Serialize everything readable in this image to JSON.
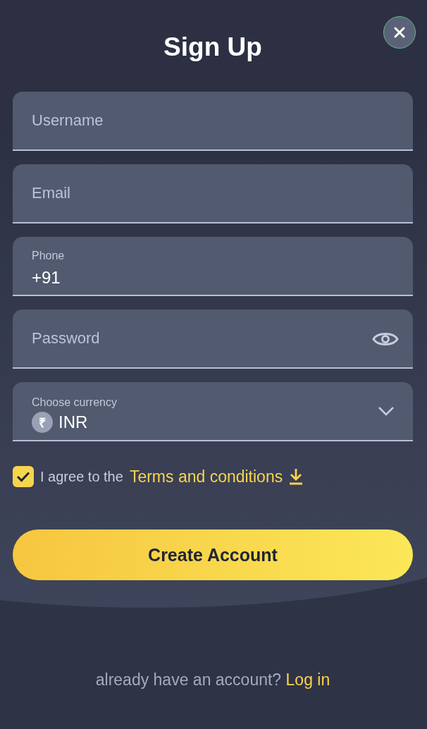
{
  "title": "Sign Up",
  "fields": [
    {
      "kind": "text",
      "placeholder": "Username"
    },
    {
      "kind": "text",
      "placeholder": "Email"
    },
    {
      "kind": "phone",
      "label": "Phone",
      "value": "+91"
    },
    {
      "kind": "password",
      "placeholder": "Password"
    },
    {
      "kind": "select",
      "label": "Choose currency",
      "symbol": "₹",
      "value": "INR"
    }
  ],
  "agree": {
    "checked": true,
    "text": "I agree to the",
    "link": "Terms and conditions"
  },
  "submit": "Create Account",
  "footer": {
    "text": "already have an account?",
    "link": "Log in"
  }
}
